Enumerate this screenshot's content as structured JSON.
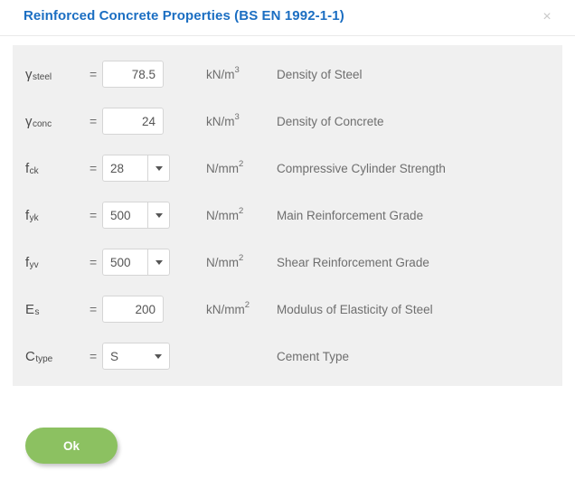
{
  "header": {
    "title": "Reinforced Concrete Properties (BS EN 1992-1-1)",
    "close_label": "×"
  },
  "colors": {
    "title": "#1b6ec2",
    "panel_bg": "#f0f0f0",
    "ok_button": "#8cc161",
    "text": "#6e6e6e"
  },
  "equals": "=",
  "rows": [
    {
      "symbol_base": "γ",
      "symbol_sub": "steel",
      "control": "text",
      "value": "78.5",
      "unit_base": "kN/m",
      "unit_sup": "3",
      "description": "Density of Steel"
    },
    {
      "symbol_base": "γ",
      "symbol_sub": "conc",
      "control": "text",
      "value": "24",
      "unit_base": "kN/m",
      "unit_sup": "3",
      "description": "Density of Concrete"
    },
    {
      "symbol_base": "f",
      "symbol_sub": "ck",
      "control": "combo",
      "value": "28",
      "unit_base": "N/mm",
      "unit_sup": "2",
      "description": "Compressive Cylinder Strength"
    },
    {
      "symbol_base": "f",
      "symbol_sub": "yk",
      "control": "combo",
      "value": "500",
      "unit_base": "N/mm",
      "unit_sup": "2",
      "description": "Main Reinforcement Grade"
    },
    {
      "symbol_base": "f",
      "symbol_sub": "yv",
      "control": "combo",
      "value": "500",
      "unit_base": "N/mm",
      "unit_sup": "2",
      "description": "Shear Reinforcement Grade"
    },
    {
      "symbol_base": "E",
      "symbol_sub": "s",
      "control": "text",
      "value": "200",
      "unit_base": "kN/mm",
      "unit_sup": "2",
      "description": "Modulus of Elasticity of Steel"
    },
    {
      "symbol_base": "C",
      "symbol_sub": "type",
      "control": "select",
      "value": "S",
      "unit_base": "",
      "unit_sup": "",
      "description": "Cement Type"
    }
  ],
  "footer": {
    "ok_label": "Ok"
  }
}
